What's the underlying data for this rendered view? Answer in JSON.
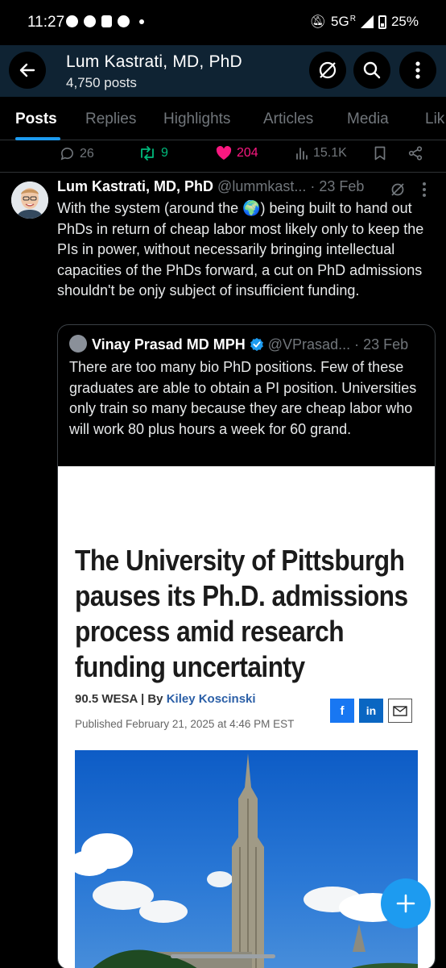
{
  "status_bar": {
    "time": "11:27",
    "network": "5G",
    "signal_label": "R",
    "battery": "25%"
  },
  "header": {
    "title": "Lum Kastrati, MD, PhD",
    "subtitle": "4,750 posts"
  },
  "tabs": [
    "Posts",
    "Replies",
    "Highlights",
    "Articles",
    "Media",
    "Lik"
  ],
  "prev_actions": {
    "replies": "26",
    "reposts": "9",
    "likes": "204",
    "views": "15.1K"
  },
  "tweet": {
    "name": "Lum Kastrati, MD, PhD",
    "handle": "@lummkast...",
    "date": "· 23 Feb",
    "text_1": "With the system (around the ",
    "globe": "🌍",
    "text_2": ") being built to hand out PhDs in return of cheap labor most likely only to keep the PIs in power, without necessarily bringing intellectual capacities of the PhDs forward, a cut on PhD admissions shouldn't be onjy subject of insufficient funding."
  },
  "quote": {
    "name": "Vinay Prasad MD MPH",
    "handle": "@VPrasad...",
    "date": "· 23 Feb",
    "text": "There are too many bio PhD positions.  Few of these graduates are able to obtain a PI position. Universities only train so many because they are cheap labor who will work 80 plus hours a week for 60 grand."
  },
  "article": {
    "title": "The University of Pittsburgh pauses its Ph.D. admissions process amid research funding uncertainty",
    "source": "90.5 WESA | By ",
    "author": "Kiley Koscinski",
    "published": "Published February 21, 2025 at 4:46 PM EST",
    "share_facebook": "f",
    "share_linkedin": "in"
  },
  "colors": {
    "accent": "#1d9bf0",
    "like": "#f91880",
    "repost": "#00ba7c",
    "header_bg": "#0f2333",
    "facebook": "#1877f2",
    "linkedin": "#0a66c2"
  }
}
